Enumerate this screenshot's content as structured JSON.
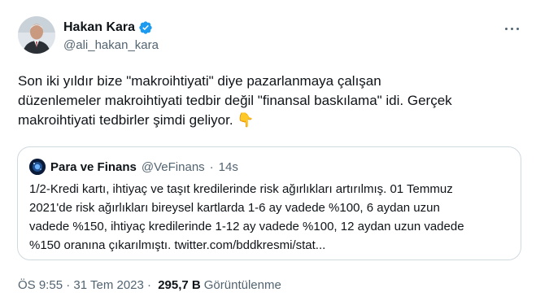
{
  "author": {
    "name": "Hakan Kara",
    "handle": "@ali_hakan_kara",
    "verified_color": "#1d9bf0"
  },
  "more_icon": "more-horizontal-icon",
  "tweet": {
    "text": "Son iki yıldır bize \"makroihtiyati\" diye pazarlanmaya çalışan\ndüzenlemeler makroihtiyati tedbir değil \"finansal baskılama\" idi. Gerçek\nmakroihtiyati tedbirler şimdi geliyor.",
    "emoji": "👇"
  },
  "quote": {
    "name": "Para ve Finans",
    "handle": "@VeFinans",
    "separator": "·",
    "time": "14s",
    "text": "1/2-Kredi kartı, ihtiyaç ve taşıt kredilerinde risk ağırlıkları artırılmış. 01 Temmuz\n2021'de risk ağırlıkları bireysel kartlarda 1-6 ay vadede %100, 6 aydan uzun\nvadede %150, ihtiyaç kredilerinde 1-12 ay vadede %100, 12 aydan uzun vadede\n%150 oranına çıkarılmıştı. twitter.com/bddkresmi/stat..."
  },
  "meta": {
    "time": "ÖS 9:55",
    "separator": " · ",
    "date": "31 Tem 2023",
    "views": "295,7 B",
    "views_label": "Görüntülenme"
  }
}
